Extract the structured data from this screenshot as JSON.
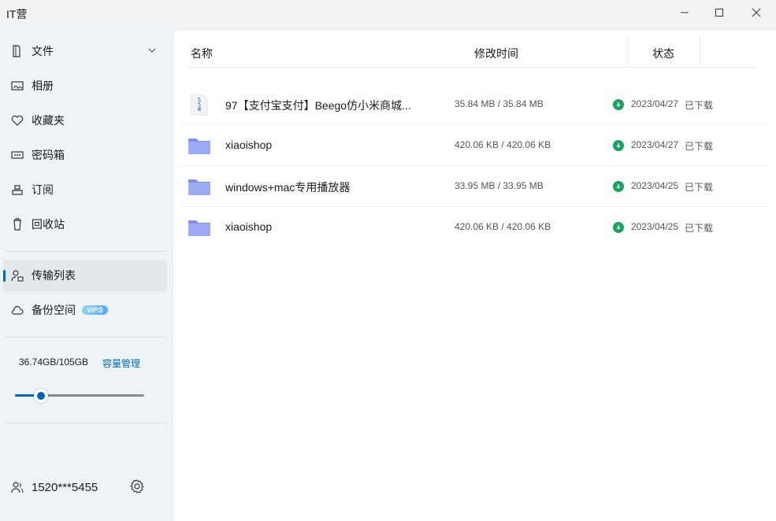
{
  "app": {
    "title": "IT营"
  },
  "sidebar": {
    "items": [
      {
        "label": "文件",
        "icon": "file-icon"
      },
      {
        "label": "相册",
        "icon": "photo-album-icon"
      },
      {
        "label": "收藏夹",
        "icon": "heart-icon"
      },
      {
        "label": "密码箱",
        "icon": "password-box-icon"
      },
      {
        "label": "订阅",
        "icon": "subscription-icon"
      },
      {
        "label": "回收站",
        "icon": "recycle-bin-icon"
      },
      {
        "label": "传输列表",
        "icon": "transfer-icon",
        "active": true
      },
      {
        "label": "备份空间",
        "icon": "cloud-icon",
        "badge": "VIPS"
      }
    ],
    "storage": {
      "used_text": "36.74GB/105GB",
      "manage_label": "容量管理",
      "fraction": 0.35
    },
    "user": {
      "name": "1520***5455"
    }
  },
  "table": {
    "headers": {
      "name": "名称",
      "time": "修改时间",
      "status": "状态"
    },
    "rows": [
      {
        "name": "97【支付宝支付】Beego仿小米商城...",
        "size": "35.84 MB / 35.84 MB",
        "date": "2023/04/27",
        "state": "已下载",
        "type": "zip"
      },
      {
        "name": "xiaoishop",
        "size": "420.06 KB / 420.06 KB",
        "date": "2023/04/27",
        "state": "已下载",
        "type": "folder"
      },
      {
        "name": "windows+mac专用播放器",
        "size": "33.95 MB / 33.95 MB",
        "date": "2023/04/25",
        "state": "已下载",
        "type": "folder"
      },
      {
        "name": "xiaoishop",
        "size": "420.06 KB / 420.06 KB",
        "date": "2023/04/25",
        "state": "已下载",
        "type": "folder"
      }
    ]
  },
  "colors": {
    "accent": "#0067c0",
    "success": "#1aa260",
    "folder": "#8c9cf5"
  }
}
